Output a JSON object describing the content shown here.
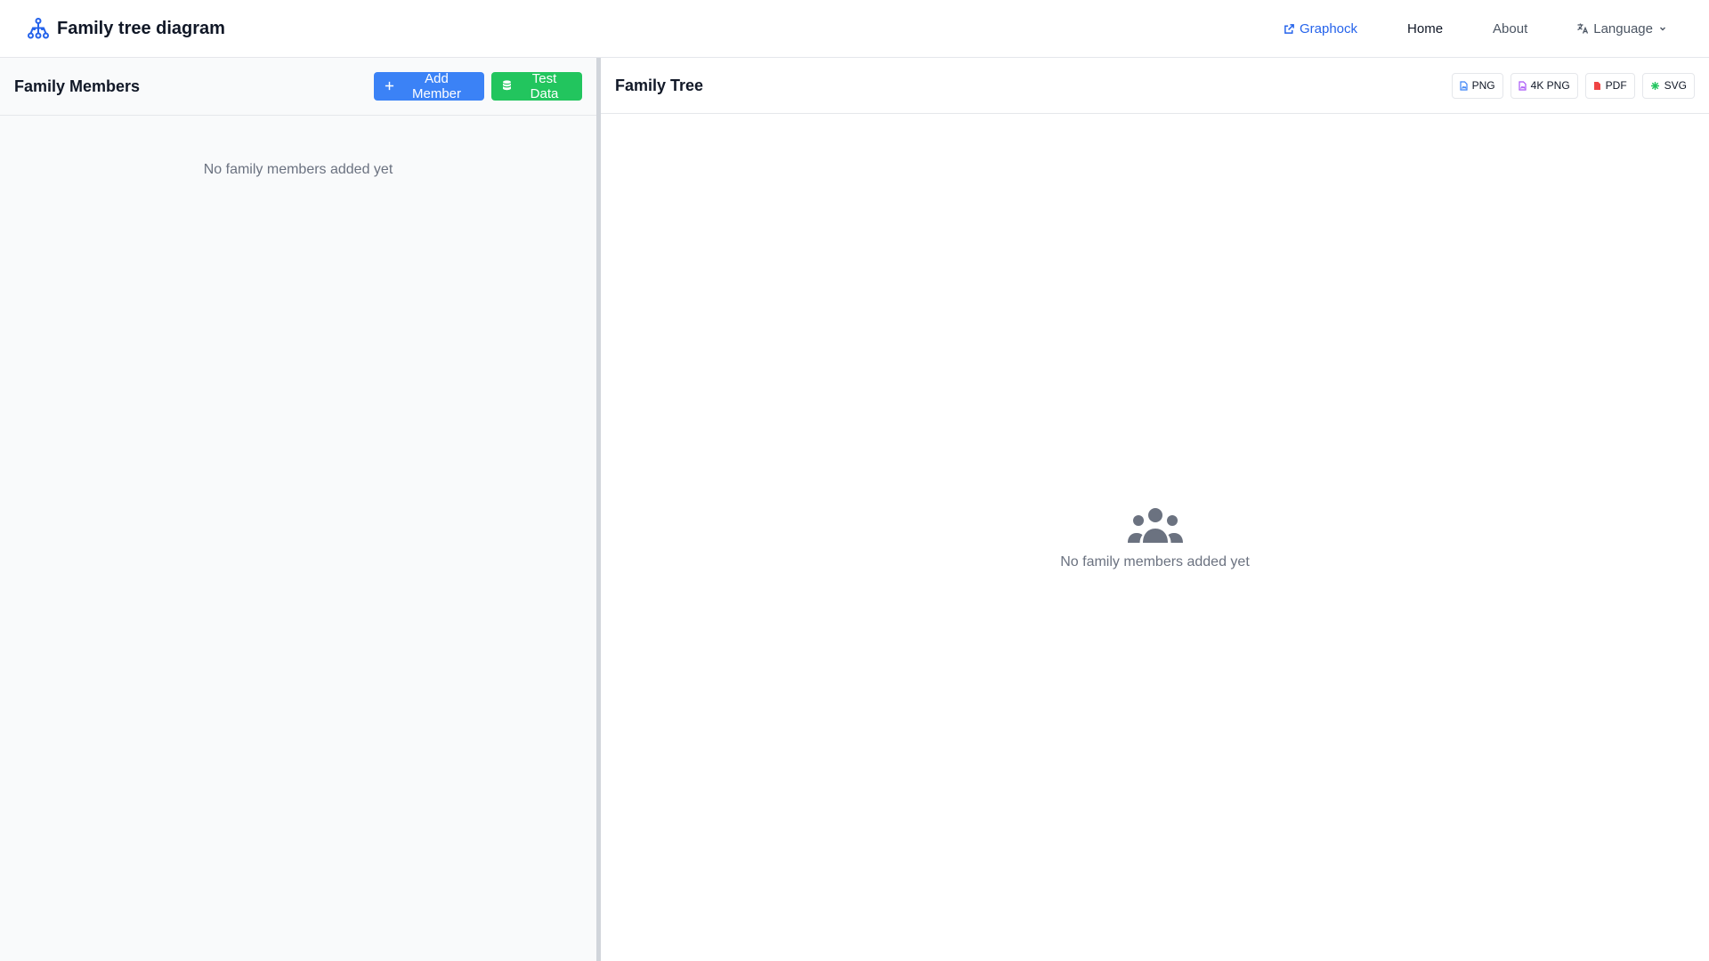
{
  "header": {
    "title": "Family tree diagram",
    "icon": "sitemap-icon",
    "nav": {
      "graphock": "Graphock",
      "home": "Home",
      "about": "About",
      "language": "Language"
    }
  },
  "left_panel": {
    "title": "Family Members",
    "add_member_label": "Add Member",
    "test_data_label": "Test Data",
    "empty_text": "No family members added yet"
  },
  "right_panel": {
    "title": "Family Tree",
    "exports": {
      "png": "PNG",
      "png4k": "4K PNG",
      "pdf": "PDF",
      "svg": "SVG"
    },
    "empty_text": "No family members added yet"
  },
  "colors": {
    "primary": "#3b82f6",
    "success": "#22c55e",
    "link": "#2563eb",
    "pdf_icon": "#ef4444",
    "png4k_icon": "#a855f7",
    "svg_icon": "#22c55e"
  }
}
